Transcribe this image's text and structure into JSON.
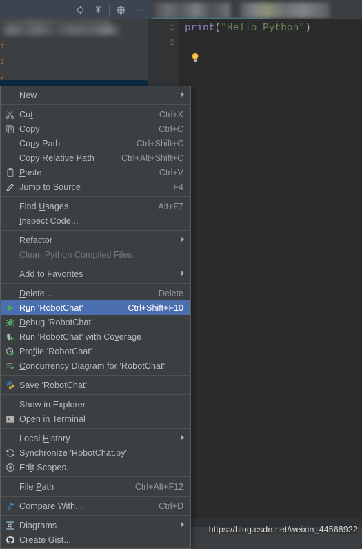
{
  "window": {
    "panel_toolbar_icons": [
      "locate-target-icon",
      "collapse-all-icon",
      "gear-icon",
      "minimize-icon"
    ]
  },
  "editor": {
    "line_numbers": [
      "1",
      "2"
    ],
    "code_tokens": [
      {
        "text": "print",
        "type": "function"
      },
      {
        "text": "(",
        "type": "punct"
      },
      {
        "text": "\"Hello Python\"",
        "type": "string"
      },
      {
        "text": ")",
        "type": "punct"
      }
    ],
    "code_plain": "print(\"Hello Python\")",
    "intention_icon": "lightbulb-icon"
  },
  "context_menu": {
    "items": [
      {
        "icon": "",
        "label": "New",
        "mnemonic": "N",
        "accel": "",
        "submenu": true,
        "state": "normal"
      },
      {
        "separator": true
      },
      {
        "icon": "scissors-icon",
        "label": "Cut",
        "mnemonic": "t",
        "accel": "Ctrl+X",
        "submenu": false,
        "state": "normal"
      },
      {
        "icon": "copy-icon",
        "label": "Copy",
        "mnemonic": "C",
        "accel": "Ctrl+C",
        "submenu": false,
        "state": "normal"
      },
      {
        "icon": "",
        "label": "Copy Path",
        "mnemonic": "p",
        "accel": "Ctrl+Shift+C",
        "submenu": false,
        "state": "normal"
      },
      {
        "icon": "",
        "label": "Copy Relative Path",
        "mnemonic": "y",
        "accel": "Ctrl+Alt+Shift+C",
        "submenu": false,
        "state": "normal"
      },
      {
        "icon": "clipboard-icon",
        "label": "Paste",
        "mnemonic": "P",
        "accel": "Ctrl+V",
        "submenu": false,
        "state": "normal"
      },
      {
        "icon": "pencil-icon",
        "label": "Jump to Source",
        "mnemonic": "",
        "accel": "F4",
        "submenu": false,
        "state": "normal"
      },
      {
        "separator": true
      },
      {
        "icon": "",
        "label": "Find Usages",
        "mnemonic": "U",
        "accel": "Alt+F7",
        "submenu": false,
        "state": "normal"
      },
      {
        "icon": "",
        "label": "Inspect Code...",
        "mnemonic": "I",
        "accel": "",
        "submenu": false,
        "state": "normal"
      },
      {
        "separator": true
      },
      {
        "icon": "",
        "label": "Refactor",
        "mnemonic": "R",
        "accel": "",
        "submenu": true,
        "state": "normal"
      },
      {
        "icon": "",
        "label": "Clean Python Compiled Files",
        "mnemonic": "",
        "accel": "",
        "submenu": false,
        "state": "disabled"
      },
      {
        "separator": true
      },
      {
        "icon": "",
        "label": "Add to Favorites",
        "mnemonic": "a",
        "accel": "",
        "submenu": true,
        "state": "normal"
      },
      {
        "separator": true
      },
      {
        "icon": "",
        "label": "Delete...",
        "mnemonic": "D",
        "accel": "Delete",
        "submenu": false,
        "state": "normal"
      },
      {
        "icon": "run-play-icon",
        "label": "Run 'RobotChat'",
        "mnemonic": "u",
        "accel": "Ctrl+Shift+F10",
        "submenu": false,
        "state": "selected"
      },
      {
        "icon": "debug-bug-icon",
        "label": "Debug 'RobotChat'",
        "mnemonic": "D",
        "accel": "",
        "submenu": false,
        "state": "normal"
      },
      {
        "icon": "coverage-icon",
        "label": "Run 'RobotChat' with Coverage",
        "mnemonic": "v",
        "accel": "",
        "submenu": false,
        "state": "normal"
      },
      {
        "icon": "profile-icon",
        "label": "Profile 'RobotChat'",
        "mnemonic": "f",
        "accel": "",
        "submenu": false,
        "state": "normal"
      },
      {
        "icon": "concurrency-diagram-icon",
        "label": "Concurrency Diagram for 'RobotChat'",
        "mnemonic": "C",
        "accel": "",
        "submenu": false,
        "state": "normal"
      },
      {
        "separator": true
      },
      {
        "icon": "python-logo-icon",
        "label": "Save 'RobotChat'",
        "mnemonic": "",
        "accel": "",
        "submenu": false,
        "state": "normal"
      },
      {
        "separator": true
      },
      {
        "icon": "",
        "label": "Show in Explorer",
        "mnemonic": "",
        "accel": "",
        "submenu": false,
        "state": "normal"
      },
      {
        "icon": "terminal-icon",
        "label": "Open in Terminal",
        "mnemonic": "",
        "accel": "",
        "submenu": false,
        "state": "normal"
      },
      {
        "separator": true
      },
      {
        "icon": "",
        "label": "Local History",
        "mnemonic": "H",
        "accel": "",
        "submenu": true,
        "state": "normal"
      },
      {
        "icon": "sync-icon",
        "label": "Synchronize 'RobotChat.py'",
        "mnemonic": "",
        "accel": "",
        "submenu": false,
        "state": "normal"
      },
      {
        "icon": "scopes-target-icon",
        "label": "Edit Scopes...",
        "mnemonic": "i",
        "accel": "",
        "submenu": false,
        "state": "normal"
      },
      {
        "separator": true
      },
      {
        "icon": "",
        "label": "File Path",
        "mnemonic": "P",
        "accel": "Ctrl+Alt+F12",
        "submenu": false,
        "state": "normal"
      },
      {
        "separator": true
      },
      {
        "icon": "compare-icon",
        "label": "Compare With...",
        "mnemonic": "C",
        "accel": "Ctrl+D",
        "submenu": false,
        "state": "normal"
      },
      {
        "separator": true
      },
      {
        "icon": "diagrams-icon",
        "label": "Diagrams",
        "mnemonic": "",
        "accel": "",
        "submenu": true,
        "state": "normal"
      },
      {
        "icon": "github-icon",
        "label": "Create Gist...",
        "mnemonic": "",
        "accel": "",
        "submenu": false,
        "state": "normal"
      }
    ]
  },
  "watermark": {
    "text": "https://blog.csdn.net/weixin_44568922"
  },
  "colors": {
    "menu_bg": "#3c3f41",
    "menu_text": "#bbbbbb",
    "selection_blue": "#4b6eaf",
    "editor_bg": "#2b2b2b",
    "string_green": "#6a8759",
    "function_violet": "#8888c6",
    "disabled_grey": "#777777"
  }
}
